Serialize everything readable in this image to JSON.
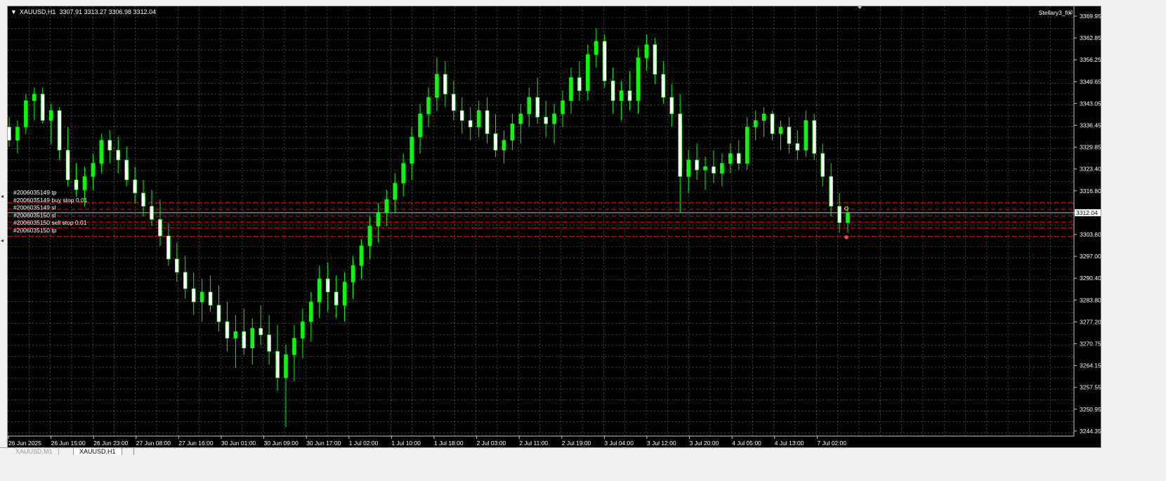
{
  "header": {
    "symbol": "XAUUSD,H1",
    "ohlc": "3307.91 3313.27 3306.98 3312.04"
  },
  "indicator": "Stellary3_fix",
  "bid_label": "3312.04",
  "colors": {
    "background": "#000000",
    "grid": "#c8c8c8",
    "bull_candle": "#00ff00",
    "bear_candle": "#ffffff",
    "order_line": "#ff0000",
    "bid_line": "#c0c0c0"
  },
  "orders": [
    {
      "label": "#2006035149 tp",
      "price": 3315.2
    },
    {
      "label": "#2006035149 buy stop 0.01",
      "price": 3313.1
    },
    {
      "label": "#2006035149 sl",
      "price": 3311.0
    },
    {
      "label": "#2006035150 sl",
      "price": 3309.2
    },
    {
      "label": "#2006035150 sell stop 0.01",
      "price": 3307.4
    },
    {
      "label": "#2006035150 tp",
      "price": 3304.8
    }
  ],
  "chart_data": {
    "type": "candlestick",
    "ylim": [
      3244.33,
      3372.9
    ],
    "y_ticks": [
      "3369.95",
      "3362.85",
      "3356.25",
      "3349.65",
      "3343.05",
      "3336.45",
      "3329.85",
      "3323.40",
      "3316.80",
      "3310.20",
      "3303.60",
      "3297.00",
      "3290.40",
      "3283.80",
      "3277.20",
      "3270.75",
      "3264.15",
      "3257.55",
      "3250.95",
      "3244.35"
    ],
    "x_ticks": [
      "26 Jun 2025",
      "26 Jun 15:00",
      "26 Jun 23:00",
      "27 Jun 08:00",
      "27 Jun 16:00",
      "30 Jun 01:00",
      "30 Jun 09:00",
      "30 Jun 17:00",
      "1 Jul 02:00",
      "1 Jul 10:00",
      "1 Jul 18:00",
      "2 Jul 03:00",
      "2 Jul 11:00",
      "2 Jul 19:00",
      "3 Jul 04:00",
      "3 Jul 12:00",
      "3 Jul 20:00",
      "4 Jul 05:00",
      "4 Jul 13:00",
      "7 Jul 02:00"
    ],
    "candles": [
      [
        3338,
        3341,
        3332,
        3334
      ],
      [
        3334,
        3340,
        3330,
        3338
      ],
      [
        3338,
        3348,
        3336,
        3346
      ],
      [
        3346,
        3350,
        3340,
        3348
      ],
      [
        3348,
        3350,
        3339,
        3340
      ],
      [
        3340,
        3345,
        3333,
        3343
      ],
      [
        3343,
        3344,
        3328,
        3331
      ],
      [
        3331,
        3338,
        3320,
        3322
      ],
      [
        3322,
        3327,
        3317,
        3319
      ],
      [
        3319,
        3326,
        3314,
        3323
      ],
      [
        3323,
        3330,
        3319,
        3327
      ],
      [
        3327,
        3336,
        3324,
        3334
      ],
      [
        3334,
        3337,
        3327,
        3331
      ],
      [
        3331,
        3335,
        3324,
        3328
      ],
      [
        3328,
        3332,
        3320,
        3322
      ],
      [
        3322,
        3326,
        3315,
        3318
      ],
      [
        3318,
        3322,
        3311,
        3314
      ],
      [
        3314,
        3319,
        3308,
        3310
      ],
      [
        3310,
        3316,
        3302,
        3305
      ],
      [
        3305,
        3309,
        3296,
        3298
      ],
      [
        3298,
        3303,
        3291,
        3294
      ],
      [
        3294,
        3299,
        3286,
        3289
      ],
      [
        3289,
        3294,
        3281,
        3285
      ],
      [
        3285,
        3292,
        3279,
        3288
      ],
      [
        3288,
        3293,
        3282,
        3284
      ],
      [
        3284,
        3290,
        3276,
        3279
      ],
      [
        3279,
        3285,
        3270,
        3274
      ],
      [
        3274,
        3281,
        3265,
        3276
      ],
      [
        3276,
        3283,
        3269,
        3271
      ],
      [
        3271,
        3280,
        3266,
        3277
      ],
      [
        3277,
        3284,
        3272,
        3275
      ],
      [
        3275,
        3281,
        3266,
        3270
      ],
      [
        3270,
        3278,
        3258,
        3262
      ],
      [
        3262,
        3272,
        3247,
        3269
      ],
      [
        3269,
        3278,
        3261,
        3274
      ],
      [
        3274,
        3283,
        3268,
        3279
      ],
      [
        3279,
        3288,
        3273,
        3285
      ],
      [
        3285,
        3296,
        3280,
        3292
      ],
      [
        3292,
        3297,
        3282,
        3288
      ],
      [
        3288,
        3293,
        3280,
        3284
      ],
      [
        3284,
        3294,
        3279,
        3291
      ],
      [
        3291,
        3299,
        3286,
        3296
      ],
      [
        3296,
        3304,
        3292,
        3302
      ],
      [
        3302,
        3311,
        3298,
        3308
      ],
      [
        3308,
        3315,
        3303,
        3312
      ],
      [
        3312,
        3319,
        3308,
        3316
      ],
      [
        3316,
        3324,
        3312,
        3321
      ],
      [
        3321,
        3330,
        3317,
        3327
      ],
      [
        3327,
        3338,
        3322,
        3335
      ],
      [
        3335,
        3345,
        3330,
        3342
      ],
      [
        3342,
        3350,
        3338,
        3347
      ],
      [
        3347,
        3359,
        3343,
        3354
      ],
      [
        3354,
        3358,
        3344,
        3348
      ],
      [
        3348,
        3352,
        3340,
        3343
      ],
      [
        3343,
        3347,
        3336,
        3340
      ],
      [
        3340,
        3344,
        3334,
        3338
      ],
      [
        3338,
        3346,
        3335,
        3343
      ],
      [
        3343,
        3347,
        3333,
        3336
      ],
      [
        3336,
        3342,
        3329,
        3331
      ],
      [
        3331,
        3337,
        3327,
        3334
      ],
      [
        3334,
        3342,
        3331,
        3339
      ],
      [
        3339,
        3345,
        3333,
        3342
      ],
      [
        3342,
        3350,
        3338,
        3347
      ],
      [
        3347,
        3353,
        3339,
        3341
      ],
      [
        3341,
        3346,
        3335,
        3339
      ],
      [
        3339,
        3345,
        3333,
        3342
      ],
      [
        3342,
        3349,
        3338,
        3346
      ],
      [
        3346,
        3356,
        3342,
        3353
      ],
      [
        3353,
        3358,
        3346,
        3349
      ],
      [
        3349,
        3363,
        3346,
        3360
      ],
      [
        3360,
        3368,
        3356,
        3364
      ],
      [
        3364,
        3366,
        3350,
        3352
      ],
      [
        3352,
        3356,
        3342,
        3346
      ],
      [
        3346,
        3352,
        3340,
        3349
      ],
      [
        3349,
        3355,
        3343,
        3346
      ],
      [
        3346,
        3362,
        3342,
        3359
      ],
      [
        3359,
        3366,
        3355,
        3363
      ],
      [
        3363,
        3365,
        3351,
        3354
      ],
      [
        3354,
        3358,
        3345,
        3347
      ],
      [
        3347,
        3351,
        3338,
        3342
      ],
      [
        3342,
        3348,
        3312,
        3323
      ],
      [
        3323,
        3331,
        3318,
        3328
      ],
      [
        3328,
        3333,
        3322,
        3325
      ],
      [
        3325,
        3329,
        3319,
        3326
      ],
      [
        3326,
        3331,
        3321,
        3324
      ],
      [
        3324,
        3330,
        3320,
        3327
      ],
      [
        3327,
        3333,
        3324,
        3330
      ],
      [
        3330,
        3334,
        3325,
        3327
      ],
      [
        3327,
        3341,
        3325,
        3338
      ],
      [
        3338,
        3343,
        3334,
        3340
      ],
      [
        3340,
        3344,
        3335,
        3342
      ],
      [
        3342,
        3343,
        3334,
        3336
      ],
      [
        3336,
        3340,
        3331,
        3338
      ],
      [
        3338,
        3341,
        3330,
        3333
      ],
      [
        3333,
        3337,
        3328,
        3331
      ],
      [
        3331,
        3343,
        3329,
        3340
      ],
      [
        3340,
        3342,
        3328,
        3330
      ],
      [
        3330,
        3333,
        3320,
        3323
      ],
      [
        3323,
        3327,
        3311,
        3314
      ],
      [
        3314,
        3318,
        3306,
        3309
      ],
      [
        3309,
        3314,
        3306,
        3312
      ]
    ]
  }
}
